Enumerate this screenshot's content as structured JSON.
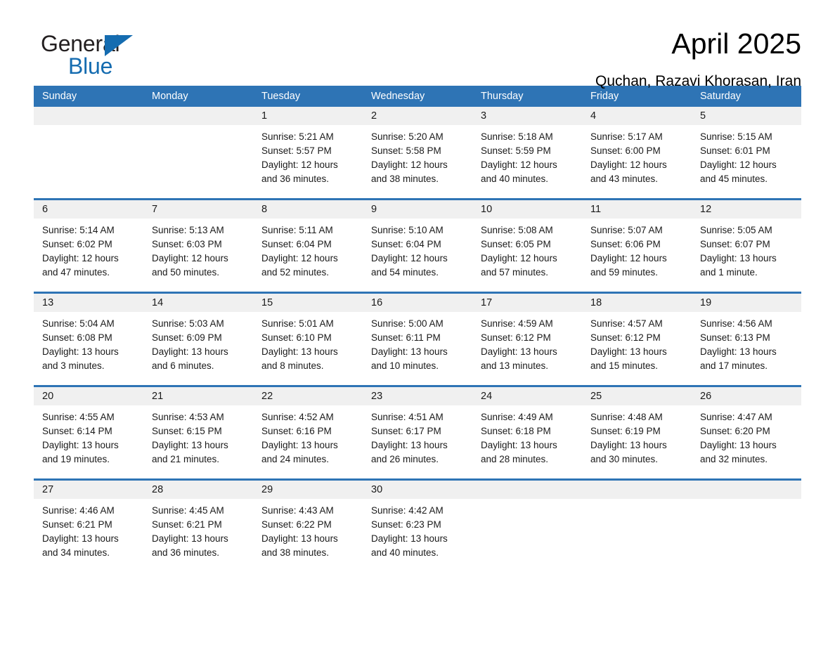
{
  "brand": {
    "name_part1": "General",
    "name_part2": "Blue",
    "accent_color": "#156cb0"
  },
  "header": {
    "title": "April 2025",
    "subtitle": "Quchan, Razavi Khorasan, Iran"
  },
  "colors": {
    "header_blue": "#2e74b5",
    "daynum_band": "#f0f0f0"
  },
  "calendar": {
    "weekdays": [
      "Sunday",
      "Monday",
      "Tuesday",
      "Wednesday",
      "Thursday",
      "Friday",
      "Saturday"
    ],
    "weeks": [
      [
        {
          "day": "",
          "sunrise": "",
          "sunset": "",
          "daylight_line1": "",
          "daylight_line2": ""
        },
        {
          "day": "",
          "sunrise": "",
          "sunset": "",
          "daylight_line1": "",
          "daylight_line2": ""
        },
        {
          "day": "1",
          "sunrise": "Sunrise: 5:21 AM",
          "sunset": "Sunset: 5:57 PM",
          "daylight_line1": "Daylight: 12 hours",
          "daylight_line2": "and 36 minutes."
        },
        {
          "day": "2",
          "sunrise": "Sunrise: 5:20 AM",
          "sunset": "Sunset: 5:58 PM",
          "daylight_line1": "Daylight: 12 hours",
          "daylight_line2": "and 38 minutes."
        },
        {
          "day": "3",
          "sunrise": "Sunrise: 5:18 AM",
          "sunset": "Sunset: 5:59 PM",
          "daylight_line1": "Daylight: 12 hours",
          "daylight_line2": "and 40 minutes."
        },
        {
          "day": "4",
          "sunrise": "Sunrise: 5:17 AM",
          "sunset": "Sunset: 6:00 PM",
          "daylight_line1": "Daylight: 12 hours",
          "daylight_line2": "and 43 minutes."
        },
        {
          "day": "5",
          "sunrise": "Sunrise: 5:15 AM",
          "sunset": "Sunset: 6:01 PM",
          "daylight_line1": "Daylight: 12 hours",
          "daylight_line2": "and 45 minutes."
        }
      ],
      [
        {
          "day": "6",
          "sunrise": "Sunrise: 5:14 AM",
          "sunset": "Sunset: 6:02 PM",
          "daylight_line1": "Daylight: 12 hours",
          "daylight_line2": "and 47 minutes."
        },
        {
          "day": "7",
          "sunrise": "Sunrise: 5:13 AM",
          "sunset": "Sunset: 6:03 PM",
          "daylight_line1": "Daylight: 12 hours",
          "daylight_line2": "and 50 minutes."
        },
        {
          "day": "8",
          "sunrise": "Sunrise: 5:11 AM",
          "sunset": "Sunset: 6:04 PM",
          "daylight_line1": "Daylight: 12 hours",
          "daylight_line2": "and 52 minutes."
        },
        {
          "day": "9",
          "sunrise": "Sunrise: 5:10 AM",
          "sunset": "Sunset: 6:04 PM",
          "daylight_line1": "Daylight: 12 hours",
          "daylight_line2": "and 54 minutes."
        },
        {
          "day": "10",
          "sunrise": "Sunrise: 5:08 AM",
          "sunset": "Sunset: 6:05 PM",
          "daylight_line1": "Daylight: 12 hours",
          "daylight_line2": "and 57 minutes."
        },
        {
          "day": "11",
          "sunrise": "Sunrise: 5:07 AM",
          "sunset": "Sunset: 6:06 PM",
          "daylight_line1": "Daylight: 12 hours",
          "daylight_line2": "and 59 minutes."
        },
        {
          "day": "12",
          "sunrise": "Sunrise: 5:05 AM",
          "sunset": "Sunset: 6:07 PM",
          "daylight_line1": "Daylight: 13 hours",
          "daylight_line2": "and 1 minute."
        }
      ],
      [
        {
          "day": "13",
          "sunrise": "Sunrise: 5:04 AM",
          "sunset": "Sunset: 6:08 PM",
          "daylight_line1": "Daylight: 13 hours",
          "daylight_line2": "and 3 minutes."
        },
        {
          "day": "14",
          "sunrise": "Sunrise: 5:03 AM",
          "sunset": "Sunset: 6:09 PM",
          "daylight_line1": "Daylight: 13 hours",
          "daylight_line2": "and 6 minutes."
        },
        {
          "day": "15",
          "sunrise": "Sunrise: 5:01 AM",
          "sunset": "Sunset: 6:10 PM",
          "daylight_line1": "Daylight: 13 hours",
          "daylight_line2": "and 8 minutes."
        },
        {
          "day": "16",
          "sunrise": "Sunrise: 5:00 AM",
          "sunset": "Sunset: 6:11 PM",
          "daylight_line1": "Daylight: 13 hours",
          "daylight_line2": "and 10 minutes."
        },
        {
          "day": "17",
          "sunrise": "Sunrise: 4:59 AM",
          "sunset": "Sunset: 6:12 PM",
          "daylight_line1": "Daylight: 13 hours",
          "daylight_line2": "and 13 minutes."
        },
        {
          "day": "18",
          "sunrise": "Sunrise: 4:57 AM",
          "sunset": "Sunset: 6:12 PM",
          "daylight_line1": "Daylight: 13 hours",
          "daylight_line2": "and 15 minutes."
        },
        {
          "day": "19",
          "sunrise": "Sunrise: 4:56 AM",
          "sunset": "Sunset: 6:13 PM",
          "daylight_line1": "Daylight: 13 hours",
          "daylight_line2": "and 17 minutes."
        }
      ],
      [
        {
          "day": "20",
          "sunrise": "Sunrise: 4:55 AM",
          "sunset": "Sunset: 6:14 PM",
          "daylight_line1": "Daylight: 13 hours",
          "daylight_line2": "and 19 minutes."
        },
        {
          "day": "21",
          "sunrise": "Sunrise: 4:53 AM",
          "sunset": "Sunset: 6:15 PM",
          "daylight_line1": "Daylight: 13 hours",
          "daylight_line2": "and 21 minutes."
        },
        {
          "day": "22",
          "sunrise": "Sunrise: 4:52 AM",
          "sunset": "Sunset: 6:16 PM",
          "daylight_line1": "Daylight: 13 hours",
          "daylight_line2": "and 24 minutes."
        },
        {
          "day": "23",
          "sunrise": "Sunrise: 4:51 AM",
          "sunset": "Sunset: 6:17 PM",
          "daylight_line1": "Daylight: 13 hours",
          "daylight_line2": "and 26 minutes."
        },
        {
          "day": "24",
          "sunrise": "Sunrise: 4:49 AM",
          "sunset": "Sunset: 6:18 PM",
          "daylight_line1": "Daylight: 13 hours",
          "daylight_line2": "and 28 minutes."
        },
        {
          "day": "25",
          "sunrise": "Sunrise: 4:48 AM",
          "sunset": "Sunset: 6:19 PM",
          "daylight_line1": "Daylight: 13 hours",
          "daylight_line2": "and 30 minutes."
        },
        {
          "day": "26",
          "sunrise": "Sunrise: 4:47 AM",
          "sunset": "Sunset: 6:20 PM",
          "daylight_line1": "Daylight: 13 hours",
          "daylight_line2": "and 32 minutes."
        }
      ],
      [
        {
          "day": "27",
          "sunrise": "Sunrise: 4:46 AM",
          "sunset": "Sunset: 6:21 PM",
          "daylight_line1": "Daylight: 13 hours",
          "daylight_line2": "and 34 minutes."
        },
        {
          "day": "28",
          "sunrise": "Sunrise: 4:45 AM",
          "sunset": "Sunset: 6:21 PM",
          "daylight_line1": "Daylight: 13 hours",
          "daylight_line2": "and 36 minutes."
        },
        {
          "day": "29",
          "sunrise": "Sunrise: 4:43 AM",
          "sunset": "Sunset: 6:22 PM",
          "daylight_line1": "Daylight: 13 hours",
          "daylight_line2": "and 38 minutes."
        },
        {
          "day": "30",
          "sunrise": "Sunrise: 4:42 AM",
          "sunset": "Sunset: 6:23 PM",
          "daylight_line1": "Daylight: 13 hours",
          "daylight_line2": "and 40 minutes."
        },
        {
          "day": "",
          "sunrise": "",
          "sunset": "",
          "daylight_line1": "",
          "daylight_line2": ""
        },
        {
          "day": "",
          "sunrise": "",
          "sunset": "",
          "daylight_line1": "",
          "daylight_line2": ""
        },
        {
          "day": "",
          "sunrise": "",
          "sunset": "",
          "daylight_line1": "",
          "daylight_line2": ""
        }
      ]
    ]
  }
}
